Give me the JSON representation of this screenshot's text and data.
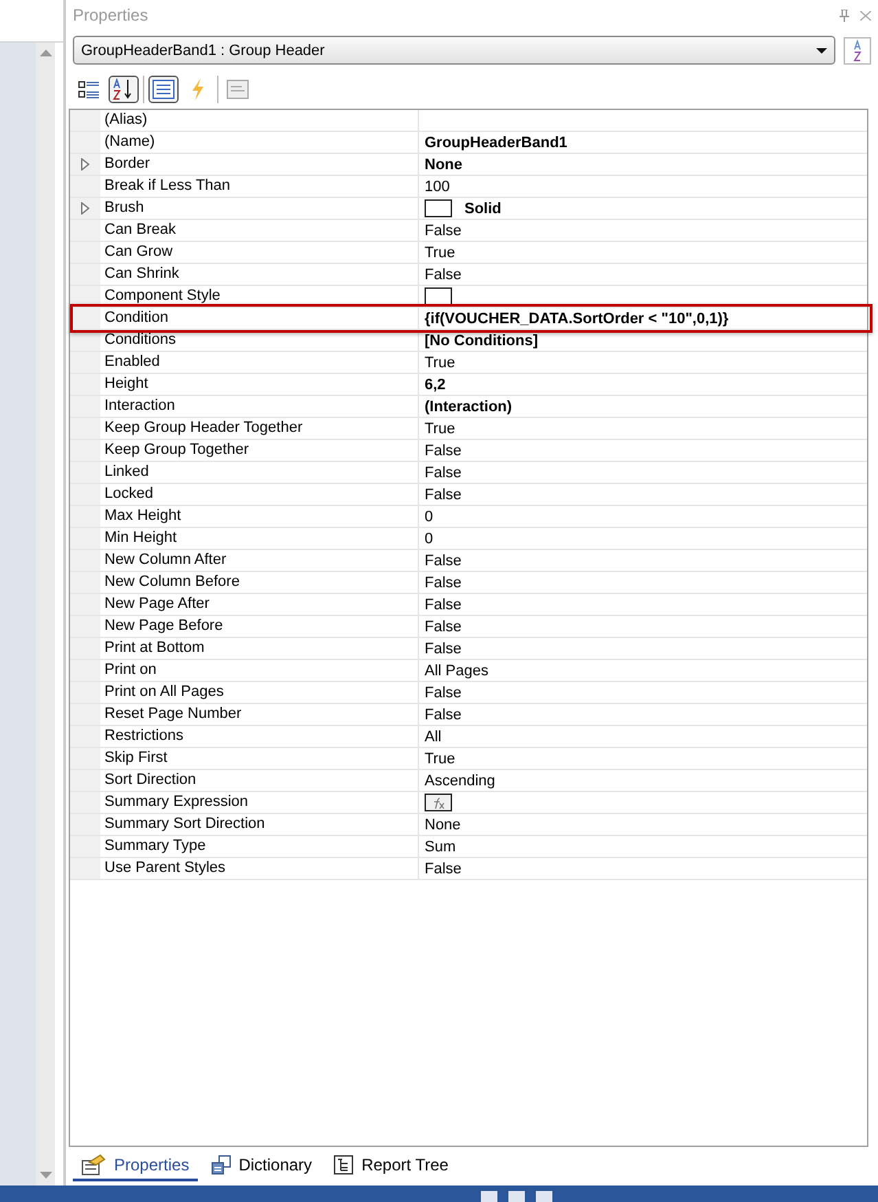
{
  "panel": {
    "title": "Properties"
  },
  "object_selector": {
    "value": "GroupHeaderBand1 : Group Header"
  },
  "toolbar": [
    {
      "kind": "categorized",
      "selected": false
    },
    {
      "kind": "alphabetical",
      "selected": true
    },
    {
      "kind": "properties",
      "selected": true
    },
    {
      "kind": "events",
      "selected": false
    },
    {
      "kind": "page",
      "selected": false
    }
  ],
  "properties": [
    {
      "name": "(Alias)",
      "kind": "text",
      "bold": false,
      "expandable": false
    },
    {
      "name": "(Name)",
      "value": "GroupHeaderBand1",
      "kind": "text",
      "bold": true,
      "expandable": false
    },
    {
      "name": "Border",
      "value": "None",
      "kind": "text",
      "bold": true,
      "expandable": true
    },
    {
      "name": "Break if Less Than",
      "value": "100",
      "kind": "text",
      "bold": false,
      "expandable": false
    },
    {
      "name": "Brush",
      "value": "Solid",
      "kind": "swatch",
      "bold": true,
      "expandable": true
    },
    {
      "name": "Can Break",
      "value": "False",
      "kind": "text",
      "bold": false,
      "expandable": false
    },
    {
      "name": "Can Grow",
      "value": "True",
      "kind": "text",
      "bold": false,
      "expandable": false
    },
    {
      "name": "Can Shrink",
      "value": "False",
      "kind": "text",
      "bold": false,
      "expandable": false
    },
    {
      "name": "Component Style",
      "kind": "swatch",
      "bold": false,
      "expandable": false
    },
    {
      "name": "Condition",
      "value": "{if(VOUCHER_DATA.SortOrder < \"10\",0,1)}",
      "kind": "text",
      "bold": true,
      "expandable": false,
      "highlighted": true
    },
    {
      "name": "Conditions",
      "value": "[No Conditions]",
      "kind": "text",
      "bold": true,
      "expandable": false
    },
    {
      "name": "Enabled",
      "value": "True",
      "kind": "text",
      "bold": false,
      "expandable": false
    },
    {
      "name": "Height",
      "value": "6,2",
      "kind": "text",
      "bold": true,
      "expandable": false
    },
    {
      "name": "Interaction",
      "value": "(Interaction)",
      "kind": "text",
      "bold": true,
      "expandable": false
    },
    {
      "name": "Keep Group Header Together",
      "value": "True",
      "kind": "text",
      "bold": false,
      "expandable": false
    },
    {
      "name": "Keep Group Together",
      "value": "False",
      "kind": "text",
      "bold": false,
      "expandable": false
    },
    {
      "name": "Linked",
      "value": "False",
      "kind": "text",
      "bold": false,
      "expandable": false
    },
    {
      "name": "Locked",
      "value": "False",
      "kind": "text",
      "bold": false,
      "expandable": false
    },
    {
      "name": "Max Height",
      "value": "0",
      "kind": "text",
      "bold": false,
      "expandable": false
    },
    {
      "name": "Min Height",
      "value": "0",
      "kind": "text",
      "bold": false,
      "expandable": false
    },
    {
      "name": "New Column After",
      "value": "False",
      "kind": "text",
      "bold": false,
      "expandable": false
    },
    {
      "name": "New Column Before",
      "value": "False",
      "kind": "text",
      "bold": false,
      "expandable": false
    },
    {
      "name": "New Page After",
      "value": "False",
      "kind": "text",
      "bold": false,
      "expandable": false
    },
    {
      "name": "New Page Before",
      "value": "False",
      "kind": "text",
      "bold": false,
      "expandable": false
    },
    {
      "name": "Print at Bottom",
      "value": "False",
      "kind": "text",
      "bold": false,
      "expandable": false
    },
    {
      "name": "Print on",
      "value": "All Pages",
      "kind": "text",
      "bold": false,
      "expandable": false
    },
    {
      "name": "Print on All Pages",
      "value": "False",
      "kind": "text",
      "bold": false,
      "expandable": false
    },
    {
      "name": "Reset Page Number",
      "value": "False",
      "kind": "text",
      "bold": false,
      "expandable": false
    },
    {
      "name": "Restrictions",
      "value": "All",
      "kind": "text",
      "bold": false,
      "expandable": false
    },
    {
      "name": "Skip First",
      "value": "True",
      "kind": "text",
      "bold": false,
      "expandable": false
    },
    {
      "name": "Sort Direction",
      "value": "Ascending",
      "kind": "text",
      "bold": false,
      "expandable": false
    },
    {
      "name": "Summary Expression",
      "kind": "expression",
      "bold": false,
      "expandable": false
    },
    {
      "name": "Summary Sort Direction",
      "value": "None",
      "kind": "text",
      "bold": false,
      "expandable": false
    },
    {
      "name": "Summary Type",
      "value": "Sum",
      "kind": "text",
      "bold": false,
      "expandable": false
    },
    {
      "name": "Use Parent Styles",
      "value": "False",
      "kind": "text",
      "bold": false,
      "expandable": false
    }
  ],
  "bottom_tabs": [
    {
      "label": "Properties",
      "kind": "properties",
      "selected": true
    },
    {
      "label": "Dictionary",
      "kind": "dictionary",
      "selected": false
    },
    {
      "label": "Report Tree",
      "kind": "tree",
      "selected": false
    }
  ]
}
